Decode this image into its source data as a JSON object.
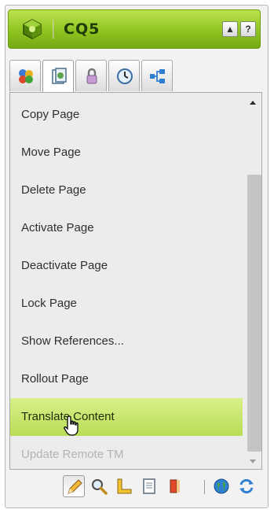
{
  "app": {
    "title": "CQ5"
  },
  "title_buttons": [
    {
      "name": "collapse",
      "glyph": "▲"
    },
    {
      "name": "help",
      "glyph": "?"
    }
  ],
  "tabs": [
    {
      "icon": "components-icon",
      "active": false
    },
    {
      "icon": "page-icon",
      "active": true
    },
    {
      "icon": "lock-icon",
      "active": false
    },
    {
      "icon": "clock-icon",
      "active": false
    },
    {
      "icon": "workflow-icon",
      "active": false
    }
  ],
  "menu": {
    "items": [
      {
        "label": "Copy Page",
        "state": "normal"
      },
      {
        "label": "Move Page",
        "state": "normal"
      },
      {
        "label": "Delete Page",
        "state": "normal"
      },
      {
        "label": "Activate Page",
        "state": "normal"
      },
      {
        "label": "Deactivate Page",
        "state": "normal"
      },
      {
        "label": "Lock Page",
        "state": "normal"
      },
      {
        "label": "Show References...",
        "state": "normal"
      },
      {
        "label": "Rollout Page",
        "state": "normal"
      },
      {
        "label": "Translate Content",
        "state": "hover"
      },
      {
        "label": "Update Remote TM",
        "state": "disabled"
      }
    ]
  },
  "toolbar": {
    "tools": [
      {
        "icon": "pencil-icon",
        "pressed": true
      },
      {
        "icon": "magnifier-icon",
        "pressed": false
      },
      {
        "icon": "ruler-icon",
        "pressed": false
      },
      {
        "icon": "document-icon",
        "pressed": false
      },
      {
        "icon": "paint-bucket-icon",
        "pressed": false
      },
      {
        "icon": "globe-icon",
        "pressed": false
      },
      {
        "icon": "refresh-icon",
        "pressed": false
      }
    ]
  },
  "colors": {
    "accent": "#8fc320",
    "hover": "#c6e56a",
    "disabled_text": "#b3b3b3"
  }
}
